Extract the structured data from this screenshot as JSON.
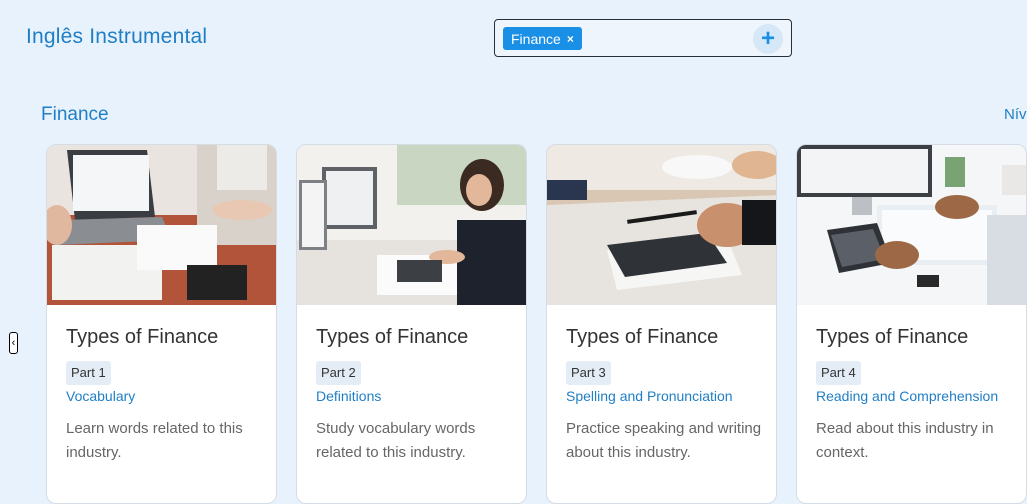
{
  "app": {
    "title": "Inglês Instrumental"
  },
  "filter": {
    "chip_label": "Finance",
    "remove_glyph": "×",
    "add_glyph": "+"
  },
  "section": {
    "title": "Finance",
    "link": "Nív"
  },
  "carousel": {
    "prev_glyph": "‹"
  },
  "cards": [
    {
      "title": "Types of Finance",
      "part": "Part 1",
      "category": "Vocabulary",
      "description": "Learn words related to this industry."
    },
    {
      "title": "Types of Finance",
      "part": "Part 2",
      "category": "Definitions",
      "description": "Study vocabulary words related to this industry."
    },
    {
      "title": "Types of Finance",
      "part": "Part 3",
      "category": "Spelling and Pronunciation",
      "description": "Practice speaking and writing about this industry."
    },
    {
      "title": "Types of Finance",
      "part": "Part 4",
      "category": "Reading and Comprehension",
      "description": "Read about this industry in context."
    }
  ],
  "icons": {
    "remove": "close-icon",
    "add": "plus-icon",
    "prev": "chevron-left-icon"
  }
}
